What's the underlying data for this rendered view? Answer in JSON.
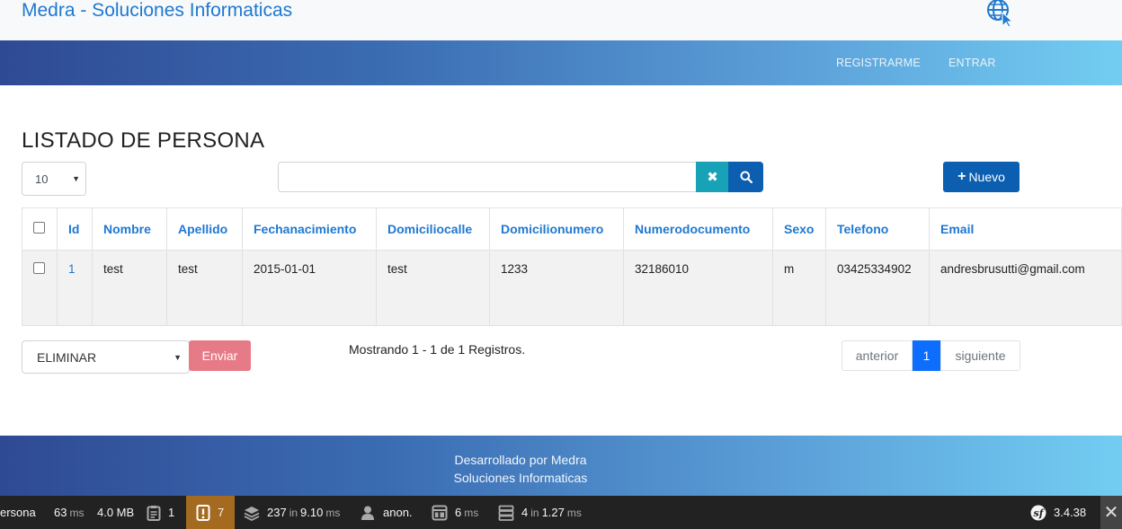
{
  "header": {
    "brand": "Medra - Soluciones Informaticas",
    "icon": "globe-cursor-icon"
  },
  "nav": {
    "register": "REGISTRARME",
    "login": "ENTRAR"
  },
  "page": {
    "title": "LISTADO DE PERSONA"
  },
  "filters": {
    "per_page": "10",
    "search_value": "",
    "new_button": "Nuevo"
  },
  "table": {
    "columns": [
      "Id",
      "Nombre",
      "Apellido",
      "Fechanacimiento",
      "Domiciliocalle",
      "Domicilionumero",
      "Numerodocumento",
      "Sexo",
      "Telefono",
      "Email"
    ],
    "rows": [
      {
        "id": "1",
        "nombre": "test",
        "apellido": "test",
        "fechanacimiento": "2015-01-01",
        "domiciliocalle": "test",
        "domicilionumero": "1233",
        "numerodocumento": "32186010",
        "sexo": "m",
        "telefono": "03425334902",
        "email": "andresbrusutti@gmail.com"
      }
    ]
  },
  "bulk": {
    "action": "ELIMINAR",
    "submit": "Enviar"
  },
  "info": {
    "records": "Mostrando 1 - 1 de 1 Registros."
  },
  "pagination": {
    "prev": "anterior",
    "current": "1",
    "next": "siguiente"
  },
  "footer": {
    "line1": "Desarrollado por Medra",
    "line2": "Soluciones Informaticas"
  },
  "debug_toolbar": {
    "route": "ersona",
    "time_value": "63",
    "time_unit": "ms",
    "memory": "4.0 MB",
    "logs": "1",
    "warnings": "7",
    "queries": "237",
    "queries_in": "in",
    "queries_time": "9.10",
    "queries_unit": "ms",
    "user": "anon.",
    "templates_value": "6",
    "templates_unit": "ms",
    "cache": "4",
    "cache_in": "in",
    "cache_time": "1.27",
    "cache_unit": "ms",
    "version": "3.4.38"
  },
  "colors": {
    "primary": "#0c5fb0",
    "link": "#1f78d1",
    "info": "#17a2b8",
    "danger_light": "#e77a87",
    "warning": "#a46a1f"
  }
}
